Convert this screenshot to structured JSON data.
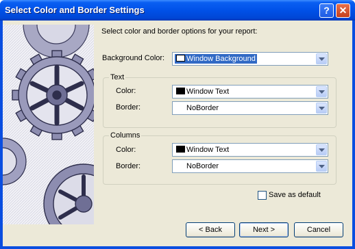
{
  "window": {
    "title": "Select Color and Border Settings"
  },
  "titlebar_buttons": {
    "help": "?",
    "close": "✕"
  },
  "intro": "Select color and border options for your report:",
  "background": {
    "label": "Background Color:",
    "value": "Window Background",
    "swatch": "#ffffff"
  },
  "text_group": {
    "legend": "Text",
    "color_label": "Color:",
    "color_value": "Window Text",
    "color_swatch": "#000000",
    "border_label": "Border:",
    "border_value": "NoBorder"
  },
  "columns_group": {
    "legend": "Columns",
    "color_label": "Color:",
    "color_value": "Window Text",
    "color_swatch": "#000000",
    "border_label": "Border:",
    "border_value": "NoBorder"
  },
  "save_default": {
    "label": "Save as default",
    "checked": false
  },
  "buttons": {
    "back": "< Back",
    "next": "Next >",
    "cancel": "Cancel"
  },
  "colors": {
    "title_bar": "#0051e8",
    "dialog_face": "#ece9d8",
    "selection": "#316ac5",
    "field_border": "#7f9db9"
  }
}
